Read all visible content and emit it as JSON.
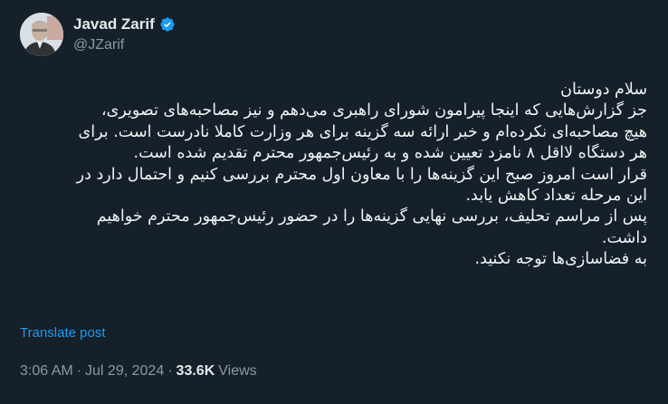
{
  "author": {
    "display_name": "Javad Zarif",
    "handle": "@JZarif",
    "verified_icon": "verified-badge-icon",
    "verified_color": "#1d9bf0"
  },
  "tweet": {
    "lines": [
      "سلام دوستان",
      "جز گزارش‌هایی که اینجا پیرامون شورای راهبری می‌دهم و نیز مصاحبه‌های تصویری،",
      "هیچ مصاحبه‌ای نکرده‌ام و خبر ارائه سه گزینه برای هر وزارت کاملا نادرست است. برای",
      "هر دستگاه لااقل ۸ نامزد تعیین شده و به رئیس‌جمهور محترم تقدیم شده است.",
      "قرار است امروز صبح این گزینه‌ها را با معاون اول محترم بررسی کنیم و احتمال دارد در",
      "این مرحله تعداد کاهش یابد.",
      "پس از مراسم تحلیف، بررسی نهایی گزینه‌ها را در حضور رئیس‌جمهور محترم خواهیم",
      "داشت.",
      "به فضاسازی‌ها توجه نکنید."
    ],
    "translate_label": "Translate post"
  },
  "meta": {
    "time": "3:06 AM",
    "separator": "·",
    "date": "Jul 29, 2024",
    "views_count": "33.6K",
    "views_label": "Views"
  },
  "colors": {
    "background": "#15202b",
    "accent": "#1d9bf0",
    "secondary_text": "#8b98a5"
  }
}
